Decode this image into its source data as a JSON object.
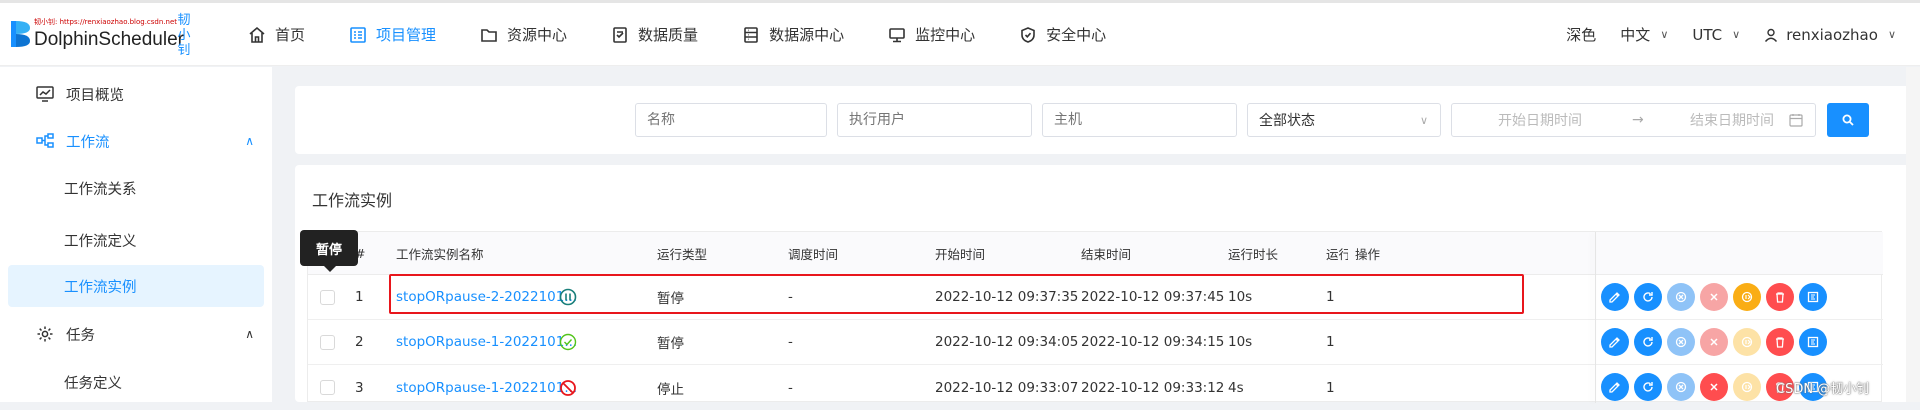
{
  "header": {
    "logo_small_text": "韧小钊: https://renxiaozhao.blog.csdn.net",
    "brand": "DolphinScheduler",
    "brand_vertical": "韧小钊",
    "nav": [
      {
        "label": "首页",
        "icon": "home-icon"
      },
      {
        "label": "项目管理",
        "icon": "project-icon",
        "active": true
      },
      {
        "label": "资源中心",
        "icon": "folder-icon"
      },
      {
        "label": "数据质量",
        "icon": "data-quality-icon"
      },
      {
        "label": "数据源中心",
        "icon": "datasource-icon"
      },
      {
        "label": "监控中心",
        "icon": "monitor-icon"
      },
      {
        "label": "安全中心",
        "icon": "shield-icon"
      }
    ],
    "theme": "深色",
    "language": "中文",
    "timezone": "UTC",
    "user": "renxiaozhao"
  },
  "sidebar": {
    "items": [
      {
        "label": "项目概览",
        "icon": "dashboard-icon"
      },
      {
        "label": "工作流",
        "icon": "workflow-icon",
        "expanded": true
      },
      {
        "label": "工作流关系"
      },
      {
        "label": "工作流定义"
      },
      {
        "label": "工作流实例",
        "active": true
      },
      {
        "label": "任务",
        "icon": "gear-icon",
        "expanded": true
      },
      {
        "label": "任务定义"
      }
    ]
  },
  "filter": {
    "name_placeholder": "名称",
    "executor_placeholder": "执行用户",
    "host_placeholder": "主机",
    "status_value": "全部状态",
    "start_date_placeholder": "开始日期时间",
    "end_date_placeholder": "结束日期时间"
  },
  "card": {
    "title": "工作流实例"
  },
  "table": {
    "columns": [
      "#",
      "工作流实例名称",
      "运行类型",
      "调度时间",
      "开始时间",
      "结束时间",
      "运行时长",
      "运行",
      "操作"
    ],
    "rows": [
      {
        "index": "1",
        "name": "stopORpause-2-2022101...",
        "state": "paused",
        "run_type": "暂停",
        "schedule_time": "-",
        "start_time": "2022-10-12 09:37:35",
        "end_time": "2022-10-12 09:37:45",
        "duration": "10s",
        "run_times": "1"
      },
      {
        "index": "2",
        "name": "stopORpause-1-2022101...",
        "state": "success",
        "run_type": "暂停",
        "schedule_time": "-",
        "start_time": "2022-10-12 09:34:05",
        "end_time": "2022-10-12 09:34:15",
        "duration": "10s",
        "run_times": "1"
      },
      {
        "index": "3",
        "name": "stopORpause-1-2022101...",
        "state": "stopped",
        "run_type": "停止",
        "schedule_time": "-",
        "start_time": "2022-10-12 09:33:07",
        "end_time": "2022-10-12 09:33:12",
        "duration": "4s",
        "run_times": "1"
      }
    ]
  },
  "tooltip": "暂停",
  "watermark": "CSDN @韧小钊",
  "colors": {
    "primary": "#1890ff",
    "success": "#52c41a",
    "danger": "#ff4d4f",
    "warning": "#faad14",
    "highlight": "#e8161c"
  }
}
